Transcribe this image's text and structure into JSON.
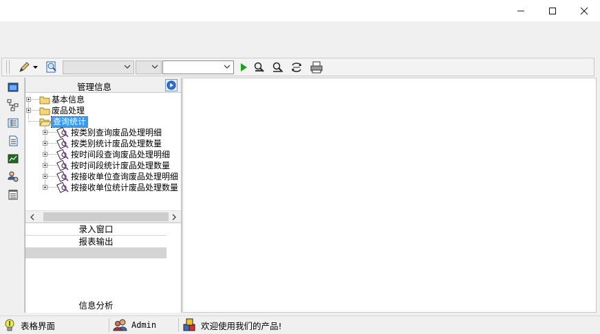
{
  "window": {
    "controls": {
      "minimize": "─",
      "maximize": "☐",
      "close": "✕"
    }
  },
  "toolbar": {
    "combo1_value": "",
    "combo2_value": "",
    "combo3_value": ""
  },
  "nav_panel": {
    "title": "管理信息",
    "tree": [
      {
        "label": "基本信息",
        "icon": "folder-closed-icon",
        "expanded": false
      },
      {
        "label": "废品处理",
        "icon": "folder-closed-icon",
        "expanded": false
      },
      {
        "label": "查询统计",
        "icon": "folder-open-icon",
        "expanded": true,
        "selected": true,
        "children": [
          {
            "label": "按类别查询废品处理明细",
            "icon": "report-icon"
          },
          {
            "label": "按类别统计废品处理数量",
            "icon": "report-icon"
          },
          {
            "label": "按时间段查询废品处理明细",
            "icon": "report-icon"
          },
          {
            "label": "按时间段统计废品处理数量",
            "icon": "report-icon"
          },
          {
            "label": "按接收单位查询废品处理明细",
            "icon": "report-icon"
          },
          {
            "label": "按接收单位统计废品处理数量",
            "icon": "report-icon"
          }
        ]
      }
    ],
    "sections": {
      "entry_window": "录入窗口",
      "report_output": "报表输出",
      "info_analysis": "信息分析"
    }
  },
  "statusbar": {
    "view": "表格界面",
    "user": "Admin",
    "message": "欢迎使用我们的产品!"
  },
  "colors": {
    "selection": "#3399ff",
    "accent_blue": "#1e5fb4",
    "run_green": "#1aa31a"
  }
}
